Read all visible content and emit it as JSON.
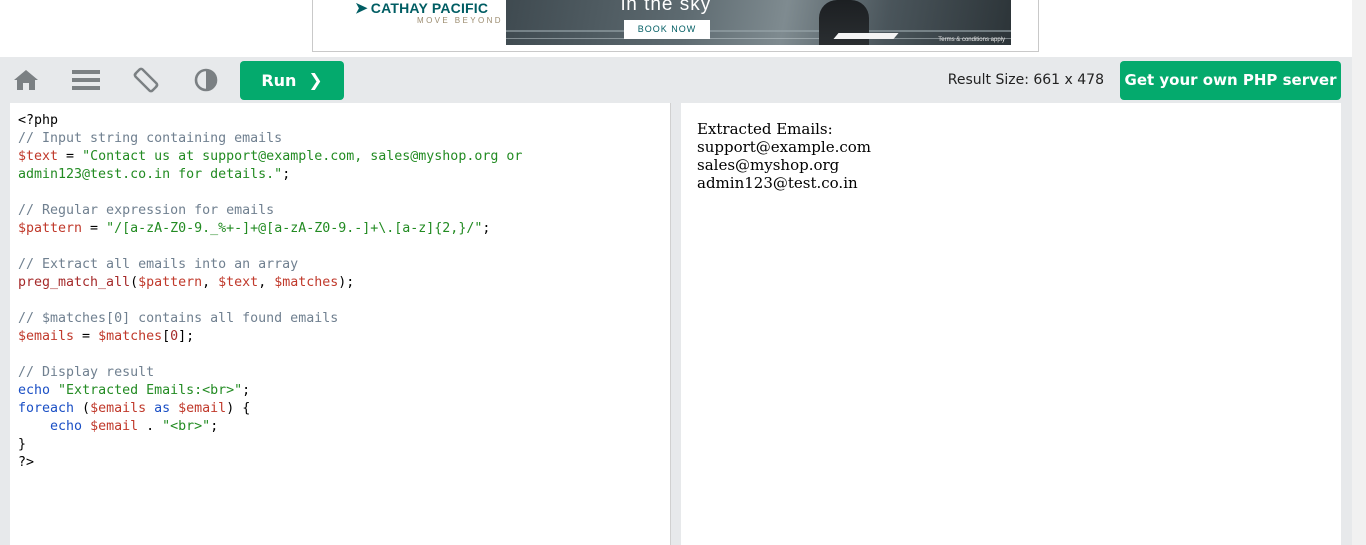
{
  "ad": {
    "brand": "CATHAY PACIFIC",
    "tagline": "MOVE BEYOND",
    "headline": "in the sky",
    "cta": "BOOK NOW",
    "terms": "Terms & conditions apply"
  },
  "toolbar": {
    "icons": [
      "home-icon",
      "menu-icon",
      "rotate-icon",
      "contrast-icon"
    ],
    "run_label": "Run",
    "result_size_text": "Result Size: 661 x 478",
    "server_button_label": "Get your own PHP server"
  },
  "editor": {
    "lines": [
      [
        {
          "t": "plain",
          "v": "<?php"
        }
      ],
      [
        {
          "t": "cm",
          "v": "// Input string containing emails"
        }
      ],
      [
        {
          "t": "var",
          "v": "$text"
        },
        {
          "t": "plain",
          "v": " = "
        },
        {
          "t": "str",
          "v": "\"Contact us at support@example.com, sales@myshop.org or"
        }
      ],
      [
        {
          "t": "str",
          "v": "admin123@test.co.in for details.\""
        },
        {
          "t": "plain",
          "v": ";"
        }
      ],
      [],
      [
        {
          "t": "cm",
          "v": "// Regular expression for emails"
        }
      ],
      [
        {
          "t": "var",
          "v": "$pattern"
        },
        {
          "t": "plain",
          "v": " = "
        },
        {
          "t": "str",
          "v": "\"/[a-zA-Z0-9._%+-]+@[a-zA-Z0-9.-]+\\.[a-z]{2,}/\""
        },
        {
          "t": "plain",
          "v": ";"
        }
      ],
      [],
      [
        {
          "t": "cm",
          "v": "// Extract all emails into an array"
        }
      ],
      [
        {
          "t": "fn",
          "v": "preg_match_all"
        },
        {
          "t": "plain",
          "v": "("
        },
        {
          "t": "var",
          "v": "$pattern"
        },
        {
          "t": "plain",
          "v": ", "
        },
        {
          "t": "var",
          "v": "$text"
        },
        {
          "t": "plain",
          "v": ", "
        },
        {
          "t": "var",
          "v": "$matches"
        },
        {
          "t": "plain",
          "v": ");"
        }
      ],
      [],
      [
        {
          "t": "cm",
          "v": "// $matches[0] contains all found emails"
        }
      ],
      [
        {
          "t": "var",
          "v": "$emails"
        },
        {
          "t": "plain",
          "v": " = "
        },
        {
          "t": "var",
          "v": "$matches"
        },
        {
          "t": "plain",
          "v": "["
        },
        {
          "t": "fn",
          "v": "0"
        },
        {
          "t": "plain",
          "v": "];"
        }
      ],
      [],
      [
        {
          "t": "cm",
          "v": "// Display result"
        }
      ],
      [
        {
          "t": "kw",
          "v": "echo"
        },
        {
          "t": "plain",
          "v": " "
        },
        {
          "t": "str",
          "v": "\"Extracted Emails:<br>\""
        },
        {
          "t": "plain",
          "v": ";"
        }
      ],
      [
        {
          "t": "kw",
          "v": "foreach"
        },
        {
          "t": "plain",
          "v": " ("
        },
        {
          "t": "var",
          "v": "$emails"
        },
        {
          "t": "plain",
          "v": " "
        },
        {
          "t": "kw",
          "v": "as"
        },
        {
          "t": "plain",
          "v": " "
        },
        {
          "t": "var",
          "v": "$email"
        },
        {
          "t": "plain",
          "v": ") {"
        }
      ],
      [
        {
          "t": "plain",
          "v": "    "
        },
        {
          "t": "kw",
          "v": "echo"
        },
        {
          "t": "plain",
          "v": " "
        },
        {
          "t": "var",
          "v": "$email"
        },
        {
          "t": "plain",
          "v": " . "
        },
        {
          "t": "str",
          "v": "\"<br>\""
        },
        {
          "t": "plain",
          "v": ";"
        }
      ],
      [
        {
          "t": "plain",
          "v": "}"
        }
      ],
      [
        {
          "t": "plain",
          "v": "?>"
        }
      ]
    ]
  },
  "result": {
    "lines": [
      "Extracted Emails:",
      "support@example.com",
      "sales@myshop.org",
      "admin123@test.co.in"
    ]
  },
  "colors": {
    "accent": "#04aa6d",
    "toolbar_bg": "#e7e9eb",
    "comment": "#708090",
    "variable": "#c0392b",
    "string": "#228b22",
    "keyword": "#1a4fc5"
  }
}
